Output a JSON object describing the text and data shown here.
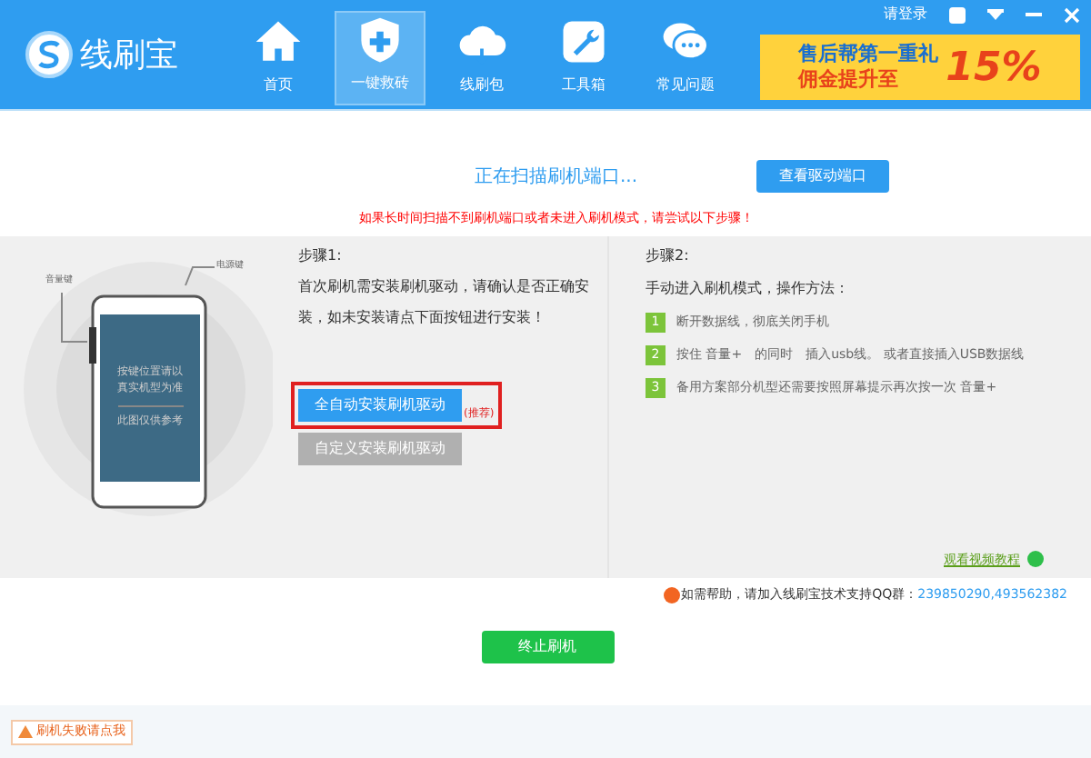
{
  "app": {
    "logo_text": "线刷宝"
  },
  "nav": [
    {
      "label": "首页",
      "selected": false
    },
    {
      "label": "一键救砖",
      "selected": true
    },
    {
      "label": "线刷包",
      "selected": false
    },
    {
      "label": "工具箱",
      "selected": false
    },
    {
      "label": "常见问题",
      "selected": false
    }
  ],
  "window_controls": {
    "login": "请登录"
  },
  "banner": {
    "line1": "售后帮第一重礼",
    "line2": "佣金提升至",
    "highlight": "15%"
  },
  "scan": {
    "status": "正在扫描刷机端口...",
    "button": "查看驱动端口",
    "warning": "如果长时间扫描不到刷机端口或者未进入刷机模式，请尝试以下步骤！"
  },
  "phone": {
    "volume_label": "音量键",
    "power_label": "电源键",
    "screen_lines": [
      "按键位置请以",
      "真实机型为准"
    ],
    "screen_note": "此图仅供参考"
  },
  "step1": {
    "title": "步骤1:",
    "text": "首次刷机需安装刷机驱动，请确认是否正确安装，如未安装请点下面按钮进行安装！",
    "primary_button": "全自动安装刷机驱动",
    "recommend": "(推荐)",
    "secondary_button": "自定义安装刷机驱动",
    "secondary_disabled": true
  },
  "step2": {
    "title": "步骤2:",
    "subtitle": "手动进入刷机模式，操作方法：",
    "items": [
      {
        "number": "1",
        "text": "断开数据线，彻底关闭手机"
      },
      {
        "number": "2",
        "text": "按住 音量+　的同时　插入usb线。 或者直接插入USB数据线"
      },
      {
        "number": "3",
        "text": "备用方案部分机型还需要按照屏幕提示再次按一次 音量+"
      }
    ],
    "video_link": "观看视频教程"
  },
  "help": {
    "text": "如需帮助，请加入线刷宝技术支持QQ群：",
    "groups": "239850290,493562382"
  },
  "stop_button": "终止刷机",
  "status_bar": {
    "fail_link": "刷机失败请点我"
  }
}
